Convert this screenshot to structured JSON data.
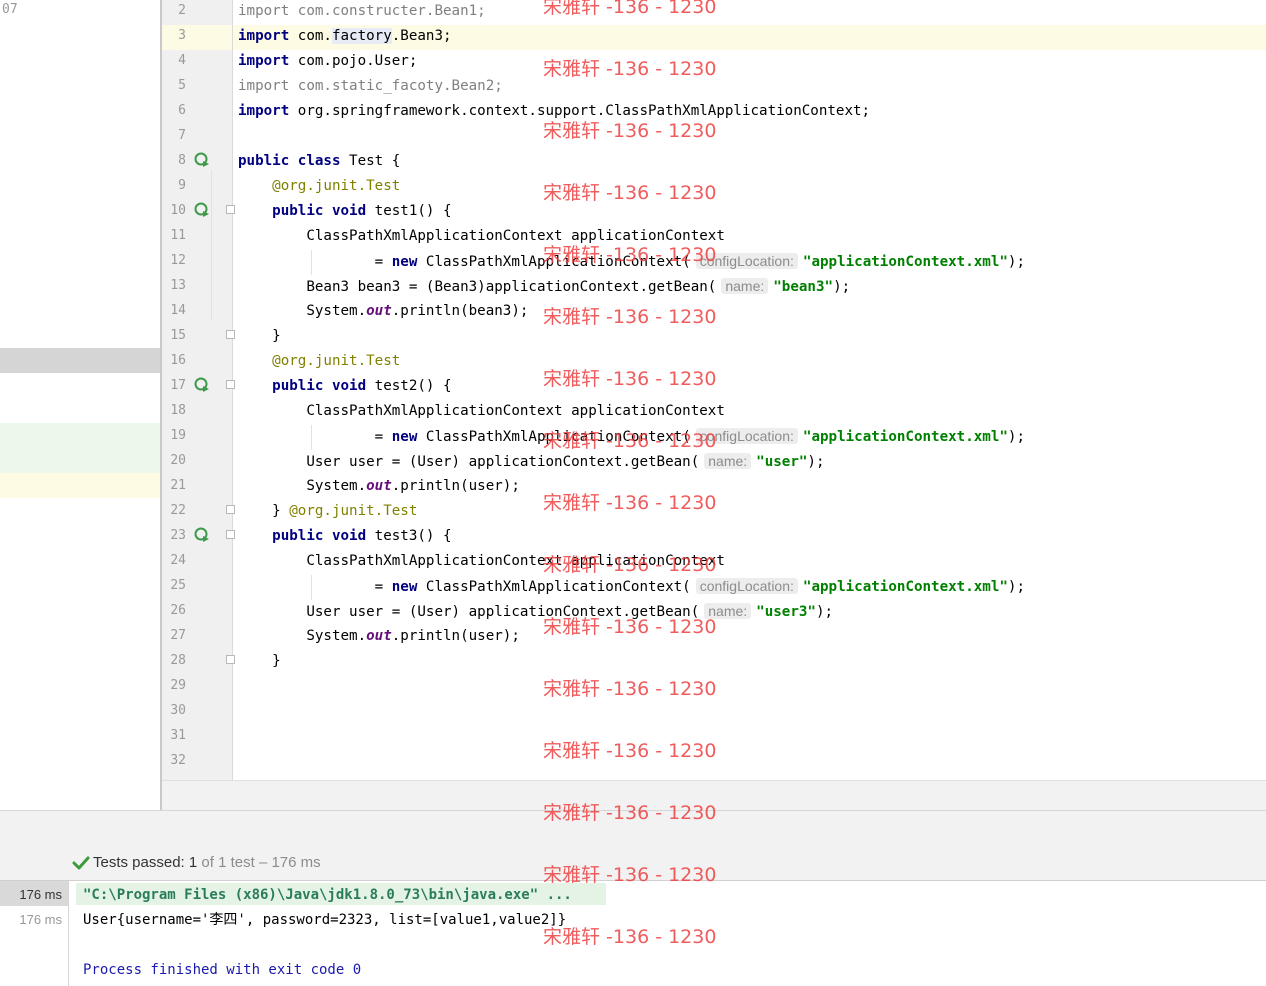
{
  "left_panel": {
    "corner_text": "07"
  },
  "editor": {
    "lines": [
      {
        "n": "2",
        "segs": [
          {
            "t": "import",
            "c": "gray"
          },
          {
            "t": " com.constructer.Bean1;",
            "c": "gray"
          }
        ]
      },
      {
        "n": "3",
        "segs": [
          {
            "t": "import",
            "c": "kw"
          },
          {
            "t": " com."
          },
          {
            "t": "factory",
            "c": "idn"
          },
          {
            "t": ".Bean3;"
          }
        ],
        "highlight": true
      },
      {
        "n": "4",
        "segs": [
          {
            "t": "import",
            "c": "kw"
          },
          {
            "t": " com.pojo.User;"
          }
        ]
      },
      {
        "n": "5",
        "segs": [
          {
            "t": "import",
            "c": "gray"
          },
          {
            "t": " com.static_facoty.Bean2;",
            "c": "gray"
          }
        ]
      },
      {
        "n": "6",
        "segs": [
          {
            "t": "import",
            "c": "kw"
          },
          {
            "t": " org.springframework.context.support.ClassPathXmlApplicationContext;"
          }
        ]
      },
      {
        "n": "7",
        "segs": []
      },
      {
        "n": "8",
        "segs": [
          {
            "t": "public class",
            "c": "kw"
          },
          {
            "t": " Test {"
          }
        ],
        "run": true
      },
      {
        "n": "9",
        "segs": [
          {
            "t": "    @org.junit.",
            "c": "ann"
          },
          {
            "t": "Test",
            "c": "ann"
          }
        ]
      },
      {
        "n": "10",
        "segs": [
          {
            "t": "    "
          },
          {
            "t": "public void",
            "c": "kw"
          },
          {
            "t": " test1() {"
          }
        ],
        "run": true,
        "fold": true
      },
      {
        "n": "11",
        "segs": [
          {
            "t": "        ClassPathXmlApplicationContext applicationContext"
          }
        ]
      },
      {
        "n": "12",
        "segs": [
          {
            "t": "                = "
          },
          {
            "t": "new",
            "c": "kw"
          },
          {
            "t": " ClassPathXmlApplicationContext("
          },
          {
            "t": "configLocation:",
            "c": "hint"
          },
          {
            "t": "\"applicationContext.xml\"",
            "c": "str"
          },
          {
            "t": ");"
          }
        ]
      },
      {
        "n": "13",
        "segs": [
          {
            "t": "        Bean3 bean3 = (Bean3)applicationContext.getBean("
          },
          {
            "t": "name:",
            "c": "hint"
          },
          {
            "t": "\"bean3\"",
            "c": "str"
          },
          {
            "t": ");"
          }
        ]
      },
      {
        "n": "14",
        "segs": [
          {
            "t": "        System."
          },
          {
            "t": "out",
            "c": "fld"
          },
          {
            "t": ".println(bean3);"
          }
        ]
      },
      {
        "n": "15",
        "segs": [
          {
            "t": "    }"
          }
        ],
        "fold": true
      },
      {
        "n": "16",
        "segs": [
          {
            "t": "    @org.junit.",
            "c": "ann"
          },
          {
            "t": "Test",
            "c": "ann"
          }
        ]
      },
      {
        "n": "17",
        "segs": [
          {
            "t": "    "
          },
          {
            "t": "public void",
            "c": "kw"
          },
          {
            "t": " test2() {"
          }
        ],
        "run": true,
        "fold": true
      },
      {
        "n": "18",
        "segs": [
          {
            "t": "        ClassPathXmlApplicationContext applicationContext"
          }
        ]
      },
      {
        "n": "19",
        "segs": [
          {
            "t": "                = "
          },
          {
            "t": "new",
            "c": "kw"
          },
          {
            "t": " ClassPathXmlApplicationContext("
          },
          {
            "t": "configLocation:",
            "c": "hint"
          },
          {
            "t": "\"applicationContext.xml\"",
            "c": "str"
          },
          {
            "t": ");"
          }
        ]
      },
      {
        "n": "20",
        "segs": [
          {
            "t": "        User user = (User) applicationContext.getBean("
          },
          {
            "t": "name:",
            "c": "hint"
          },
          {
            "t": "\"user\"",
            "c": "str"
          },
          {
            "t": ");"
          }
        ]
      },
      {
        "n": "21",
        "segs": [
          {
            "t": "        System."
          },
          {
            "t": "out",
            "c": "fld"
          },
          {
            "t": ".println(user);"
          }
        ]
      },
      {
        "n": "22",
        "segs": [
          {
            "t": "    } "
          },
          {
            "t": "@org.junit.",
            "c": "ann"
          },
          {
            "t": "Test",
            "c": "ann"
          }
        ],
        "fold": true
      },
      {
        "n": "23",
        "segs": [
          {
            "t": "    "
          },
          {
            "t": "public void",
            "c": "kw"
          },
          {
            "t": " test3() {"
          }
        ],
        "run": true,
        "fold": true
      },
      {
        "n": "24",
        "segs": [
          {
            "t": "        ClassPathXmlApplicationContext applicationContext"
          }
        ]
      },
      {
        "n": "25",
        "segs": [
          {
            "t": "                = "
          },
          {
            "t": "new",
            "c": "kw"
          },
          {
            "t": " ClassPathXmlApplicationContext("
          },
          {
            "t": "configLocation:",
            "c": "hint"
          },
          {
            "t": "\"applicationContext.xml\"",
            "c": "str"
          },
          {
            "t": ");"
          }
        ]
      },
      {
        "n": "26",
        "segs": [
          {
            "t": "        User user = (User) applicationContext.getBean("
          },
          {
            "t": "name:",
            "c": "hint"
          },
          {
            "t": "\"user3\"",
            "c": "str"
          },
          {
            "t": ");"
          }
        ]
      },
      {
        "n": "27",
        "segs": [
          {
            "t": "        System."
          },
          {
            "t": "out",
            "c": "fld"
          },
          {
            "t": ".println(user);"
          }
        ]
      },
      {
        "n": "28",
        "segs": [
          {
            "t": "    }"
          }
        ],
        "fold": true
      },
      {
        "n": "29",
        "segs": []
      },
      {
        "n": "30",
        "segs": []
      },
      {
        "n": "31",
        "segs": []
      },
      {
        "n": "32",
        "segs": []
      }
    ]
  },
  "watermark": "宋雅轩 -136 - 1230",
  "run_panel": {
    "status": {
      "passed_label": "Tests passed:",
      "passed_count": "1",
      "rest": "of 1 test – 176 ms"
    },
    "timings": [
      "176 ms",
      "176 ms"
    ],
    "console": {
      "command": "\"C:\\Program Files (x86)\\Java\\jdk1.8.0_73\\bin\\java.exe\" ...",
      "output": "User{username='李四', password=2323, list=[value1,value2]}",
      "exit": "Process finished with exit code 0"
    }
  },
  "colors": {
    "keyword": "#000080",
    "string": "#008000",
    "annotation": "#808000",
    "watermark": "#ee4040",
    "check": "#3c9a3c"
  }
}
